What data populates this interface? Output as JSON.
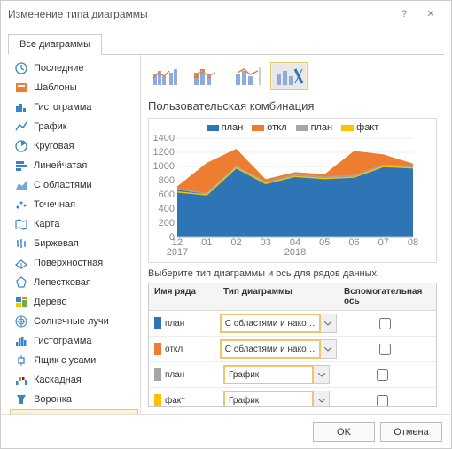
{
  "dialog": {
    "title": "Изменение типа диаграммы"
  },
  "tab": {
    "all": "Все диаграммы"
  },
  "sidebar": {
    "items": [
      {
        "label": "Последние",
        "icon": "recent"
      },
      {
        "label": "Шаблоны",
        "icon": "templates"
      },
      {
        "label": "Гистограмма",
        "icon": "bar"
      },
      {
        "label": "График",
        "icon": "line"
      },
      {
        "label": "Круговая",
        "icon": "pie"
      },
      {
        "label": "Линейчатая",
        "icon": "hbar"
      },
      {
        "label": "С областями",
        "icon": "area"
      },
      {
        "label": "Точечная",
        "icon": "scatter"
      },
      {
        "label": "Карта",
        "icon": "map"
      },
      {
        "label": "Биржевая",
        "icon": "stock"
      },
      {
        "label": "Поверхностная",
        "icon": "surface"
      },
      {
        "label": "Лепестковая",
        "icon": "radar"
      },
      {
        "label": "Дерево",
        "icon": "tree"
      },
      {
        "label": "Солнечные лучи",
        "icon": "sunburst"
      },
      {
        "label": "Гистограмма",
        "icon": "histo"
      },
      {
        "label": "Ящик с усами",
        "icon": "boxw"
      },
      {
        "label": "Каскадная",
        "icon": "waterfall"
      },
      {
        "label": "Воронка",
        "icon": "funnel"
      },
      {
        "label": "Комбинированная",
        "icon": "combo"
      }
    ],
    "selected": 18
  },
  "main": {
    "title": "Пользовательская комбинация",
    "grid_label": "Выберите тип диаграммы и ось для рядов данных:",
    "hdr_name": "Имя ряда",
    "hdr_type": "Тип диаграммы",
    "hdr_sec": "Вспомогательная ось"
  },
  "chart_data": {
    "type": "area",
    "title": "",
    "xlabel": "",
    "ylabel": "",
    "ylim": [
      0,
      1400
    ],
    "yticks": [
      0,
      200,
      400,
      600,
      800,
      1000,
      1200,
      1400
    ],
    "categories": [
      "12",
      "01",
      "02",
      "03",
      "04",
      "05",
      "06",
      "07",
      "08"
    ],
    "x_groups": [
      "2017",
      "2018"
    ],
    "legend": [
      "план",
      "откл",
      "план",
      "факт"
    ],
    "colors": {
      "план_area": "#2E75B6",
      "откл_area": "#ED7D31",
      "план_line": "#A6A6A6",
      "факт_line": "#FFC000"
    },
    "series": [
      {
        "name": "план",
        "type": "area",
        "color": "#2E75B6",
        "values": [
          680,
          620,
          1000,
          780,
          880,
          850,
          870,
          1020,
          1000
        ]
      },
      {
        "name": "откл",
        "type": "area_stack",
        "color": "#ED7D31",
        "values": [
          40,
          430,
          250,
          40,
          40,
          40,
          350,
          150,
          40
        ]
      },
      {
        "name": "план",
        "type": "line",
        "color": "#A6A6A6",
        "values": [
          680,
          620,
          1000,
          780,
          880,
          850,
          870,
          1020,
          1000
        ]
      },
      {
        "name": "факт",
        "type": "line",
        "color": "#FFC000",
        "values": [
          640,
          600,
          980,
          760,
          860,
          830,
          850,
          1000,
          980
        ]
      }
    ]
  },
  "series_rows": [
    {
      "name": "план",
      "color": "#2E75B6",
      "type": "С областями и нако…"
    },
    {
      "name": "откл",
      "color": "#ED7D31",
      "type": "С областями и нако…"
    },
    {
      "name": "план",
      "color": "#A6A6A6",
      "type": "График"
    },
    {
      "name": "факт",
      "color": "#FFC000",
      "type": "График"
    }
  ],
  "footer": {
    "ok": "OK",
    "cancel": "Отмена"
  }
}
